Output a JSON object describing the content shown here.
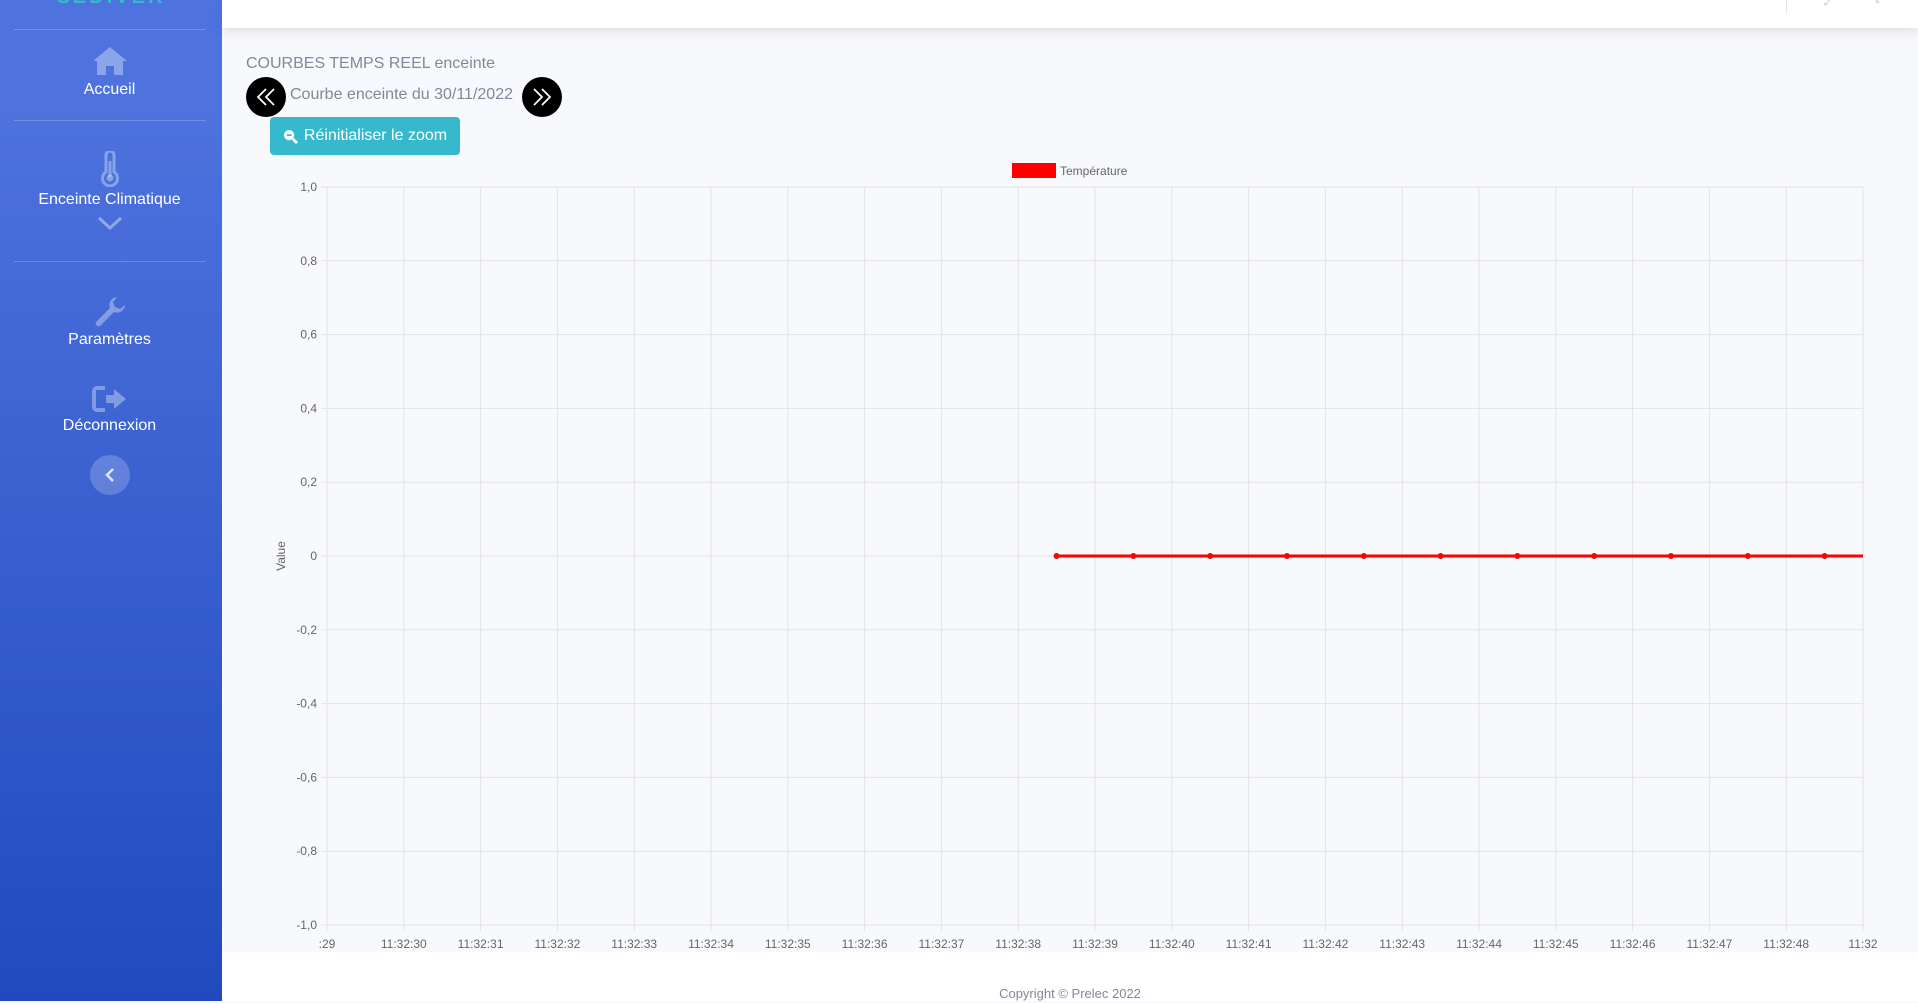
{
  "sidebar": {
    "brand": "SEDIVER",
    "items": [
      {
        "label": "Accueil",
        "icon": "home-icon"
      },
      {
        "label": "Enceinte Climatique",
        "icon": "thermometer-icon"
      },
      {
        "label": "Paramètres",
        "icon": "wrench-icon"
      },
      {
        "label": "Déconnexion",
        "icon": "sign-out-icon"
      }
    ],
    "toggle_icon": "chevron-left-icon"
  },
  "page": {
    "title": "COURBES TEMPS REEL enceinte",
    "subtitle": "Courbe enceinte du 30/11/2022",
    "reset_zoom_label": "Réinitialiser le zoom"
  },
  "footer": {
    "copyright": "Copyright © Prelec 2022"
  },
  "colors": {
    "accent": "#4e73df",
    "series": "#ff0000",
    "button": "#36b9cc"
  },
  "chart_data": {
    "type": "line",
    "title": "",
    "xlabel": "",
    "ylabel": "Value",
    "ylim": [
      -1.0,
      1.0
    ],
    "yticks": [
      "1,0",
      "0,8",
      "0,6",
      "0,4",
      "0,2",
      "0",
      "-0,2",
      "-0,4",
      "-0,6",
      "-0,8",
      "-1,0"
    ],
    "xtick_labels": [
      ":29",
      "11:32:30",
      "11:32:31",
      "11:32:32",
      "11:32:33",
      "11:32:34",
      "11:32:35",
      "11:32:36",
      "11:32:37",
      "11:32:38",
      "11:32:39",
      "11:32:40",
      "11:32:41",
      "11:32:42",
      "11:32:43",
      "11:32:44",
      "11:32:45",
      "11:32:46",
      "11:32:47",
      "11:32:48",
      "11:32"
    ],
    "xlim": [
      29.0,
      49.0
    ],
    "legend": "top",
    "grid": true,
    "series": [
      {
        "name": "Température",
        "color": "#ff0000",
        "x": [
          38.5,
          39.5,
          40.5,
          41.5,
          42.5,
          43.5,
          44.5,
          45.5,
          46.5,
          47.5,
          48.5
        ],
        "y": [
          0,
          0,
          0,
          0,
          0,
          0,
          0,
          0,
          0,
          0,
          0
        ],
        "line_end_x": 49.0
      }
    ]
  }
}
